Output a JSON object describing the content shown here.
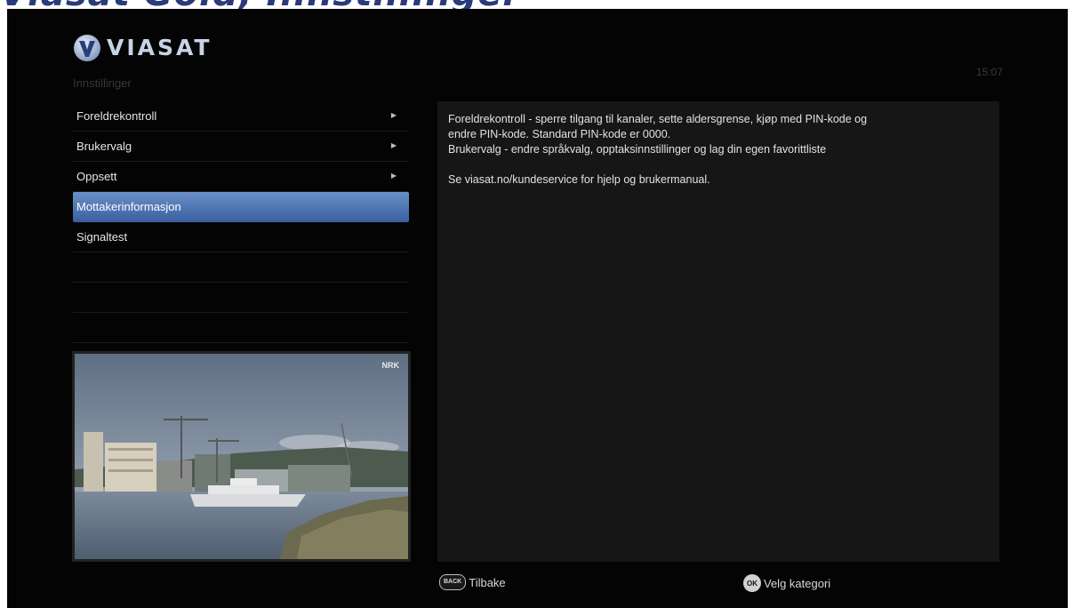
{
  "top_strip": {
    "text": "Viasat Gold, Innstillinger"
  },
  "header": {
    "brand": "VIASAT",
    "page_title": "Innstillinger",
    "clock": "15:07"
  },
  "menu": {
    "items": [
      {
        "label": "Foreldrekontroll",
        "has_submenu": true
      },
      {
        "label": "Brukervalg",
        "has_submenu": true
      },
      {
        "label": "Oppsett",
        "has_submenu": true
      },
      {
        "label": "Mottakerinformasjon",
        "selected": true
      },
      {
        "label": "Signaltest"
      }
    ]
  },
  "preview": {
    "channel_logo": "NRK"
  },
  "info": {
    "line1": "Foreldrekontroll - sperre tilgang til kanaler, sette aldersgrense, kjøp med PIN-kode og",
    "line2": "endre PIN-kode. Standard PIN-kode er 0000.",
    "line3": "Brukervalg - endre språkvalg, opptaksinnstillinger og lag din egen favorittliste",
    "line4": "Se viasat.no/kundeservice for hjelp og brukermanual."
  },
  "footer": {
    "back_key": "BACK",
    "back_label": "Tilbake",
    "ok_key": "OK",
    "ok_label": "Velg kategori"
  },
  "colors": {
    "background": "#040404",
    "selected_item": "#4f78b8",
    "info_panel": "#161616",
    "brand_text": "#c9d3e6"
  }
}
